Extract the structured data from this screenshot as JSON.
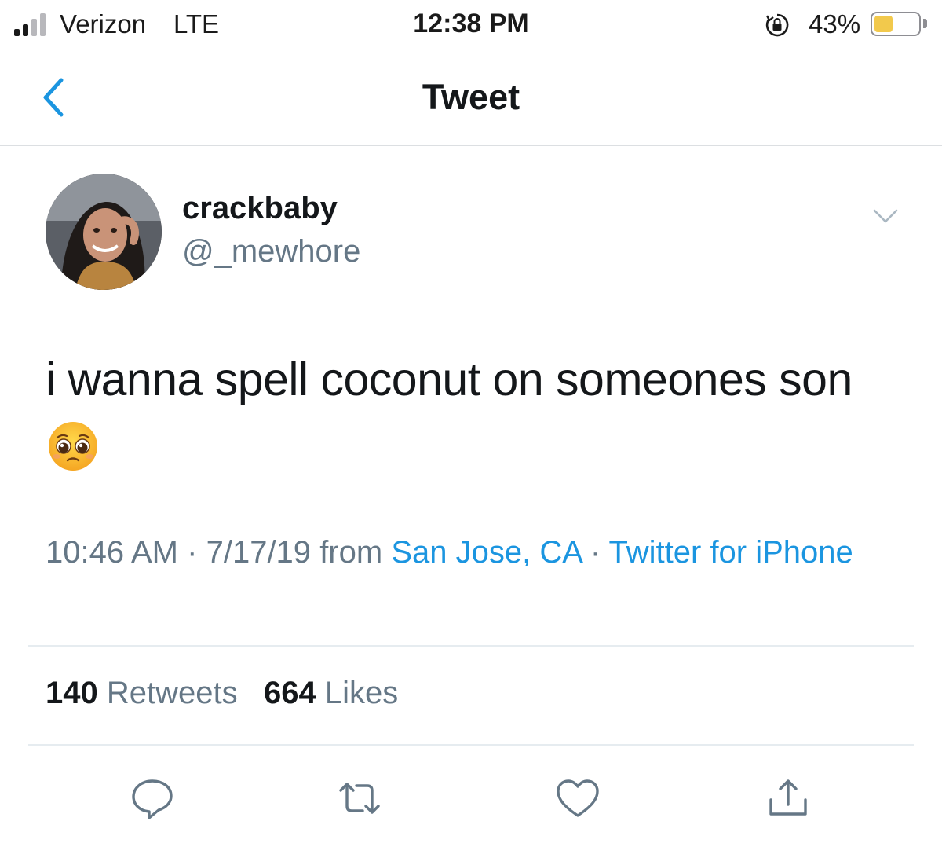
{
  "status_bar": {
    "carrier": "Verizon",
    "network": "LTE",
    "time": "12:38 PM",
    "battery_percent": "43%",
    "battery_level": 0.43,
    "signal_bars_filled": 2,
    "signal_bars_total": 4,
    "icons": [
      "signal-icon",
      "orientation-lock-icon",
      "battery-icon"
    ]
  },
  "nav": {
    "title": "Tweet",
    "back_icon": "chevron-left-icon"
  },
  "tweet": {
    "display_name": "crackbaby",
    "handle": "@_mewhore",
    "text": "i wanna spell coconut on someones son",
    "emoji": "pleading-face",
    "time": "10:46 AM",
    "date": "7/17/19",
    "from_label": "from",
    "location": "San Jose, CA",
    "separator": "·",
    "client": "Twitter for iPhone"
  },
  "stats": {
    "retweets_count": "140",
    "retweets_label": "Retweets",
    "likes_count": "664",
    "likes_label": "Likes"
  },
  "actions": [
    "reply-icon",
    "retweet-icon",
    "like-icon",
    "share-icon"
  ],
  "colors": {
    "link": "#1b95e0",
    "text": "#14171a",
    "secondary": "#657786",
    "battery": "#f2c94c"
  }
}
